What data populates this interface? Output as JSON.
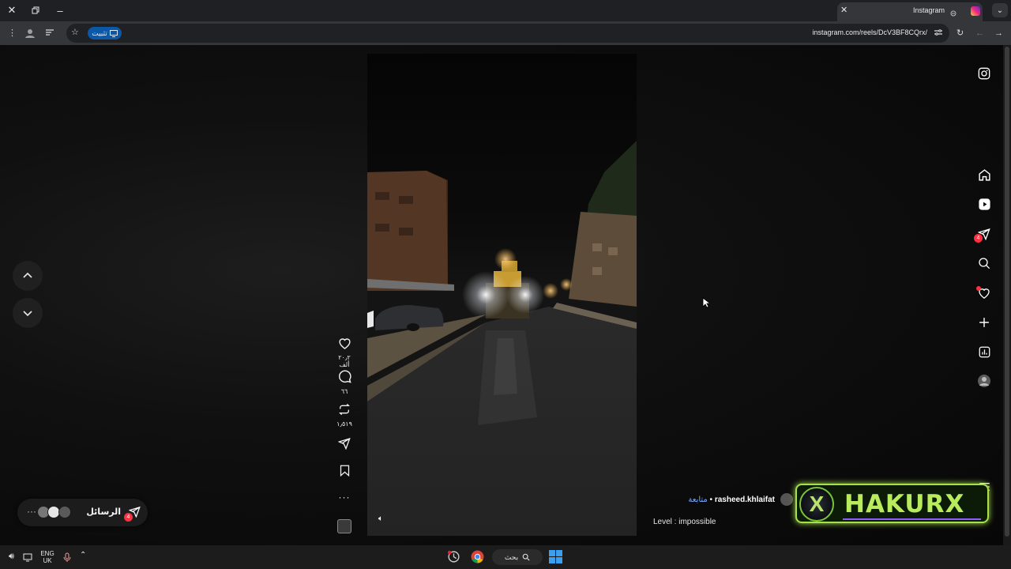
{
  "browser": {
    "tab_title": "Instagram",
    "url": "instagram.com/reels/DcV3BF8CQrx/",
    "install_label": "تثبيت"
  },
  "reel": {
    "likes": "٢٠٫٢ ألف",
    "comments": "٦٦",
    "reposts": "١٫٥١٩",
    "author": "rasheed.khlaifat",
    "follow_label": "متابعة",
    "separator": "•",
    "caption": "Level : impossible"
  },
  "sidebar": {
    "messages_badge": "4"
  },
  "messages_pill": {
    "label": "الرسائل",
    "badge": "4",
    "more": "···"
  },
  "watermark": {
    "text": "HAKURX",
    "logo": "X"
  },
  "taskbar": {
    "lang_top": "ENG",
    "lang_bottom": "UK",
    "search_label": "بحث"
  },
  "icons": {
    "instagram": "instagram-icon",
    "home": "home-icon",
    "reels": "reels-icon",
    "messages": "paper-plane-icon",
    "search": "search-icon",
    "notifications": "heart-icon",
    "create": "plus-icon",
    "dashboard": "insights-icon",
    "more": "menu-icon"
  },
  "colors": {
    "badge": "#ff3040",
    "follow_link": "#7aa9ff",
    "watermark_accent": "#b8ec5d",
    "install_pill": "#0b57a8"
  }
}
